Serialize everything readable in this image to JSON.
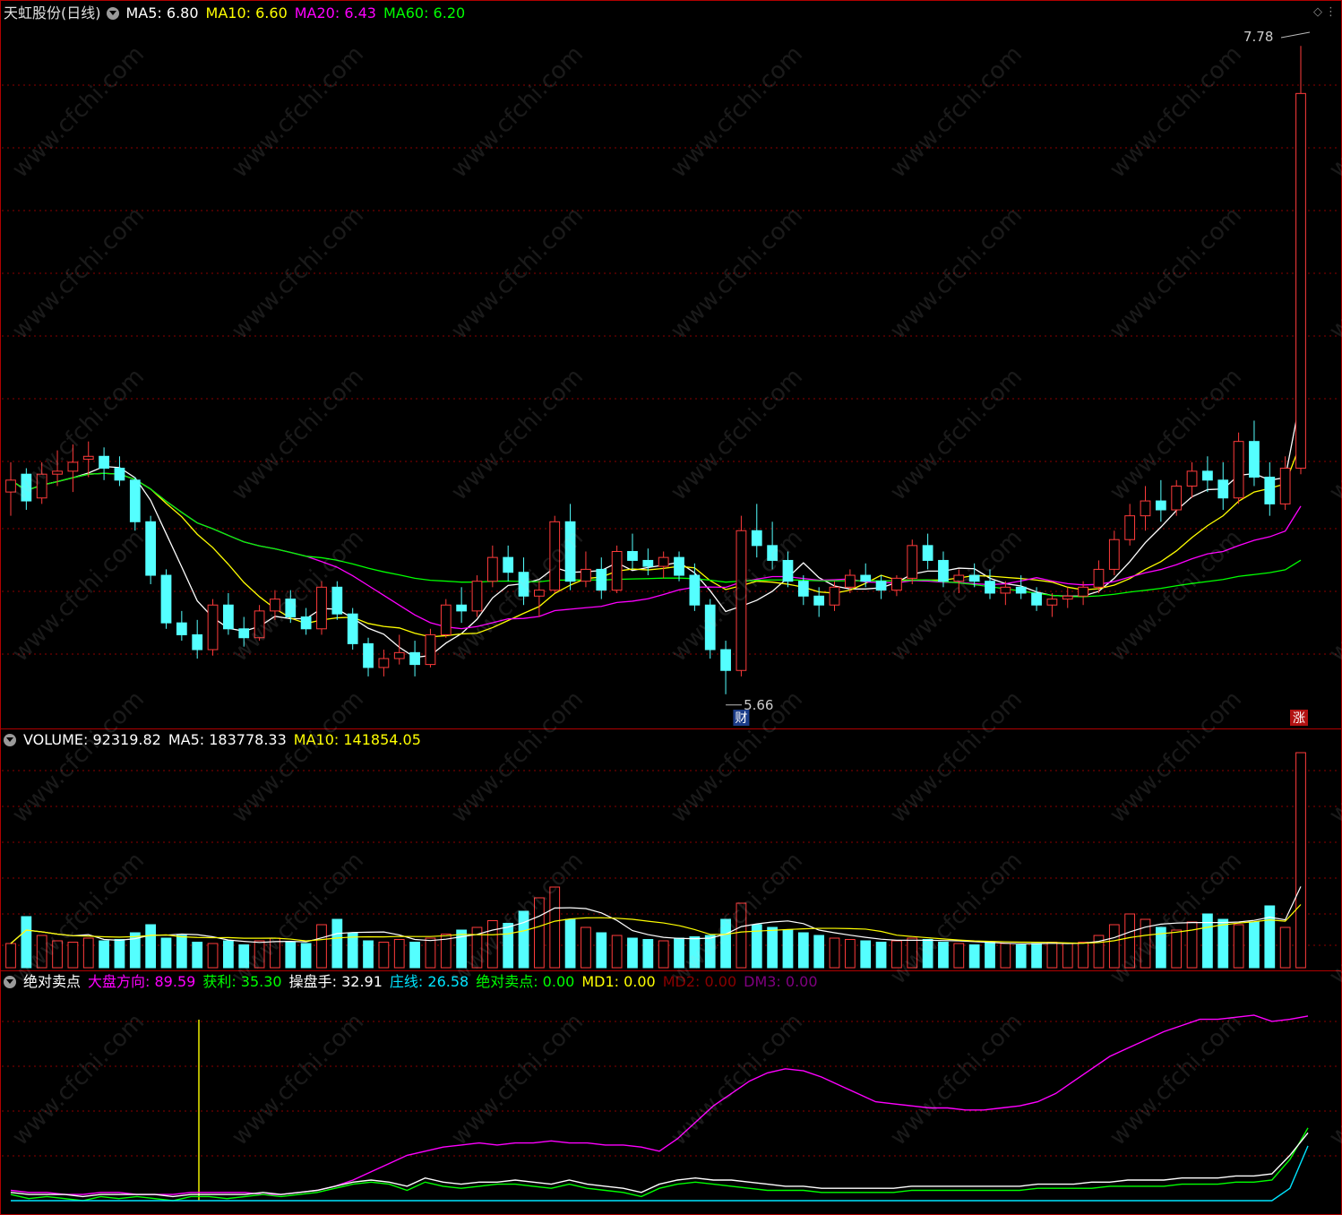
{
  "header": {
    "stock": "天虹股份(日线)",
    "ma": [
      {
        "label": "MA5: 6.80",
        "color": "#ffffff"
      },
      {
        "label": "MA10: 6.60",
        "color": "#ffff00"
      },
      {
        "label": "MA20: 6.43",
        "color": "#ff00ff"
      },
      {
        "label": "MA60: 6.20",
        "color": "#00ff00"
      }
    ]
  },
  "volume_header": [
    {
      "label": "VOLUME: 92319.82",
      "color": "#ffffff"
    },
    {
      "label": "MA5: 183778.33",
      "color": "#ffffff"
    },
    {
      "label": "MA10: 141854.05",
      "color": "#ffff00"
    }
  ],
  "indicator_header": {
    "name": "绝对卖点",
    "items": [
      {
        "label": "大盘方向: 89.59",
        "color": "#ff00ff"
      },
      {
        "label": "获利: 35.30",
        "color": "#00ff00"
      },
      {
        "label": "操盘手: 32.91",
        "color": "#ffffff"
      },
      {
        "label": "庄线: 26.58",
        "color": "#00e5ff"
      },
      {
        "label": "绝对卖点: 0.00",
        "color": "#00ff00"
      },
      {
        "label": "MD1: 0.00",
        "color": "#ffff00"
      },
      {
        "label": "MD2: 0.00",
        "color": "#8b0000"
      },
      {
        "label": "DM3: 0.00",
        "color": "#800080"
      }
    ]
  },
  "annotations": {
    "low_label": "5.66",
    "high_label": "7.78",
    "event_cai": "财",
    "event_zhang": "涨"
  },
  "watermark_text": "www.cfchi.com",
  "colors": {
    "up": "#ff3b3b",
    "down": "#54ffff",
    "ma5": "#ffffff",
    "ma10": "#ffff00",
    "ma20": "#ff00ff",
    "ma60": "#00ff00",
    "grid": "#8b0000"
  },
  "chart_data": [
    {
      "type": "candlestick",
      "title": "天虹股份(日线)",
      "ylim": [
        5.5,
        7.85
      ],
      "low_marker": 5.66,
      "high_marker": 7.78,
      "ohlc": [
        [
          6.28,
          6.38,
          6.2,
          6.32
        ],
        [
          6.34,
          6.36,
          6.22,
          6.25
        ],
        [
          6.26,
          6.38,
          6.24,
          6.34
        ],
        [
          6.34,
          6.42,
          6.3,
          6.35
        ],
        [
          6.35,
          6.44,
          6.28,
          6.38
        ],
        [
          6.39,
          6.45,
          6.33,
          6.4
        ],
        [
          6.4,
          6.43,
          6.32,
          6.36
        ],
        [
          6.36,
          6.4,
          6.3,
          6.32
        ],
        [
          6.32,
          6.33,
          6.15,
          6.18
        ],
        [
          6.18,
          6.2,
          5.97,
          6.0
        ],
        [
          6.0,
          6.02,
          5.82,
          5.84
        ],
        [
          5.84,
          5.88,
          5.78,
          5.8
        ],
        [
          5.8,
          5.85,
          5.72,
          5.75
        ],
        [
          5.75,
          5.92,
          5.73,
          5.9
        ],
        [
          5.9,
          5.94,
          5.8,
          5.82
        ],
        [
          5.82,
          5.86,
          5.76,
          5.79
        ],
        [
          5.79,
          5.9,
          5.78,
          5.88
        ],
        [
          5.88,
          5.95,
          5.85,
          5.92
        ],
        [
          5.92,
          5.95,
          5.84,
          5.86
        ],
        [
          5.86,
          5.89,
          5.8,
          5.82
        ],
        [
          5.82,
          5.98,
          5.8,
          5.96
        ],
        [
          5.96,
          5.98,
          5.85,
          5.87
        ],
        [
          5.87,
          5.89,
          5.75,
          5.77
        ],
        [
          5.77,
          5.79,
          5.66,
          5.69
        ],
        [
          5.69,
          5.75,
          5.66,
          5.72
        ],
        [
          5.72,
          5.8,
          5.7,
          5.74
        ],
        [
          5.74,
          5.78,
          5.66,
          5.7
        ],
        [
          5.7,
          5.82,
          5.69,
          5.8
        ],
        [
          5.8,
          5.92,
          5.79,
          5.9
        ],
        [
          5.9,
          5.96,
          5.84,
          5.88
        ],
        [
          5.88,
          6.0,
          5.86,
          5.98
        ],
        [
          5.98,
          6.1,
          5.96,
          6.06
        ],
        [
          6.06,
          6.1,
          5.98,
          6.01
        ],
        [
          6.01,
          6.06,
          5.9,
          5.93
        ],
        [
          5.93,
          5.98,
          5.86,
          5.95
        ],
        [
          5.95,
          6.2,
          5.94,
          6.18
        ],
        [
          6.18,
          6.24,
          5.95,
          5.98
        ],
        [
          5.98,
          6.08,
          5.96,
          6.02
        ],
        [
          6.02,
          6.06,
          5.92,
          5.95
        ],
        [
          5.95,
          6.1,
          5.94,
          6.08
        ],
        [
          6.08,
          6.14,
          6.02,
          6.05
        ],
        [
          6.05,
          6.09,
          6.0,
          6.03
        ],
        [
          6.03,
          6.08,
          5.99,
          6.06
        ],
        [
          6.06,
          6.08,
          5.98,
          6.0
        ],
        [
          6.0,
          6.04,
          5.88,
          5.9
        ],
        [
          5.9,
          5.92,
          5.72,
          5.75
        ],
        [
          5.75,
          5.78,
          5.6,
          5.68
        ],
        [
          5.68,
          6.2,
          5.66,
          6.15
        ],
        [
          6.15,
          6.24,
          6.06,
          6.1
        ],
        [
          6.1,
          6.18,
          6.02,
          6.05
        ],
        [
          6.05,
          6.08,
          5.96,
          5.98
        ],
        [
          5.98,
          6.0,
          5.9,
          5.93
        ],
        [
          5.93,
          5.96,
          5.86,
          5.9
        ],
        [
          5.9,
          5.98,
          5.88,
          5.96
        ],
        [
          5.96,
          6.02,
          5.94,
          6.0
        ],
        [
          6.0,
          6.04,
          5.96,
          5.98
        ],
        [
          5.98,
          6.0,
          5.92,
          5.95
        ],
        [
          5.95,
          6.0,
          5.93,
          5.99
        ],
        [
          5.99,
          6.12,
          5.97,
          6.1
        ],
        [
          6.1,
          6.14,
          6.02,
          6.05
        ],
        [
          6.05,
          6.08,
          5.96,
          5.98
        ],
        [
          5.98,
          6.02,
          5.94,
          6.0
        ],
        [
          6.0,
          6.04,
          5.96,
          5.98
        ],
        [
          5.98,
          6.02,
          5.92,
          5.94
        ],
        [
          5.94,
          5.98,
          5.9,
          5.96
        ],
        [
          5.96,
          6.0,
          5.92,
          5.94
        ],
        [
          5.94,
          5.96,
          5.88,
          5.9
        ],
        [
          5.9,
          5.94,
          5.86,
          5.92
        ],
        [
          5.92,
          5.96,
          5.89,
          5.93
        ],
        [
          5.93,
          5.98,
          5.9,
          5.96
        ],
        [
          5.96,
          6.05,
          5.94,
          6.02
        ],
        [
          6.02,
          6.15,
          6.0,
          6.12
        ],
        [
          6.12,
          6.24,
          6.1,
          6.2
        ],
        [
          6.2,
          6.3,
          6.15,
          6.25
        ],
        [
          6.25,
          6.32,
          6.18,
          6.22
        ],
        [
          6.22,
          6.32,
          6.2,
          6.3
        ],
        [
          6.3,
          6.38,
          6.26,
          6.35
        ],
        [
          6.35,
          6.4,
          6.28,
          6.32
        ],
        [
          6.32,
          6.38,
          6.22,
          6.26
        ],
        [
          6.26,
          6.48,
          6.24,
          6.45
        ],
        [
          6.45,
          6.52,
          6.3,
          6.33
        ],
        [
          6.33,
          6.38,
          6.2,
          6.24
        ],
        [
          6.24,
          6.4,
          6.22,
          6.36
        ],
        [
          6.36,
          7.78,
          6.34,
          7.62
        ]
      ],
      "series": [
        {
          "name": "MA5",
          "color": "#ffffff"
        },
        {
          "name": "MA10",
          "color": "#ffff00"
        },
        {
          "name": "MA20",
          "color": "#ff00ff"
        },
        {
          "name": "MA60",
          "color": "#00ff00"
        }
      ]
    },
    {
      "type": "bar",
      "title": "VOLUME",
      "ylim": [
        0,
        800000
      ],
      "values": [
        90000,
        190000,
        120000,
        100000,
        95000,
        110000,
        100000,
        105000,
        130000,
        160000,
        110000,
        120000,
        95000,
        90000,
        100000,
        85000,
        100000,
        110000,
        95000,
        90000,
        160000,
        180000,
        130000,
        100000,
        95000,
        105000,
        95000,
        110000,
        125000,
        140000,
        150000,
        175000,
        165000,
        210000,
        260000,
        300000,
        180000,
        150000,
        130000,
        120000,
        110000,
        105000,
        100000,
        110000,
        115000,
        120000,
        180000,
        240000,
        160000,
        150000,
        140000,
        130000,
        120000,
        110000,
        105000,
        100000,
        95000,
        100000,
        110000,
        105000,
        95000,
        90000,
        85000,
        95000,
        90000,
        85000,
        90000,
        95000,
        90000,
        95000,
        120000,
        160000,
        200000,
        180000,
        150000,
        140000,
        170000,
        200000,
        180000,
        160000,
        170000,
        230000,
        150000,
        800000
      ],
      "series": [
        {
          "name": "MA5",
          "color": "#ffffff"
        },
        {
          "name": "MA10",
          "color": "#ffff00"
        }
      ]
    },
    {
      "type": "line",
      "title": "绝对卖点",
      "series": [
        {
          "name": "大盘方向",
          "color": "#ff00ff",
          "values": [
            5,
            4,
            4,
            3,
            3,
            4,
            4,
            3,
            3,
            3,
            4,
            4,
            4,
            4,
            3,
            3,
            4,
            5,
            7,
            10,
            14,
            18,
            22,
            24,
            26,
            27,
            28,
            27,
            28,
            28,
            29,
            28,
            28,
            27,
            27,
            26,
            24,
            30,
            38,
            46,
            52,
            58,
            62,
            64,
            63,
            60,
            56,
            52,
            48,
            47,
            46,
            45,
            45,
            44,
            44,
            45,
            46,
            48,
            52,
            58,
            64,
            70,
            74,
            78,
            82,
            85,
            88,
            88,
            89,
            90,
            87,
            88,
            89.59
          ]
        },
        {
          "name": "获利",
          "color": "#00ff00",
          "values": [
            3,
            1,
            2,
            1,
            0,
            2,
            1,
            2,
            1,
            0,
            2,
            2,
            1,
            2,
            3,
            2,
            3,
            4,
            6,
            8,
            9,
            8,
            5,
            9,
            7,
            6,
            7,
            8,
            8,
            7,
            6,
            8,
            6,
            5,
            4,
            2,
            6,
            8,
            9,
            8,
            7,
            6,
            5,
            5,
            5,
            4,
            4,
            4,
            4,
            4,
            5,
            5,
            5,
            5,
            5,
            5,
            5,
            6,
            6,
            6,
            6,
            7,
            7,
            7,
            7,
            8,
            8,
            8,
            9,
            9,
            10,
            20,
            35.3
          ]
        },
        {
          "name": "操盘手",
          "color": "#ffffff",
          "values": [
            4,
            3,
            3,
            3,
            2,
            3,
            3,
            3,
            3,
            2,
            3,
            3,
            3,
            3,
            4,
            3,
            4,
            5,
            7,
            9,
            10,
            9,
            7,
            11,
            9,
            8,
            9,
            9,
            10,
            9,
            8,
            10,
            8,
            7,
            6,
            4,
            8,
            10,
            11,
            10,
            10,
            9,
            8,
            7,
            7,
            6,
            6,
            6,
            6,
            6,
            7,
            7,
            7,
            7,
            7,
            7,
            7,
            8,
            8,
            8,
            9,
            9,
            10,
            10,
            10,
            11,
            11,
            11,
            12,
            12,
            13,
            22,
            32.91
          ]
        },
        {
          "name": "庄线",
          "color": "#00e5ff",
          "values": [
            0,
            0,
            0,
            0,
            0,
            0,
            0,
            0,
            0,
            0,
            0,
            0,
            0,
            0,
            0,
            0,
            0,
            0,
            0,
            0,
            0,
            0,
            0,
            0,
            0,
            0,
            0,
            0,
            0,
            0,
            0,
            0,
            0,
            0,
            0,
            0,
            0,
            0,
            0,
            0,
            0,
            0,
            0,
            0,
            0,
            0,
            0,
            0,
            0,
            0,
            0,
            0,
            0,
            0,
            0,
            0,
            0,
            0,
            0,
            0,
            0,
            0,
            0,
            0,
            0,
            0,
            0,
            0,
            0,
            0,
            0,
            6,
            26.58
          ]
        }
      ]
    }
  ]
}
